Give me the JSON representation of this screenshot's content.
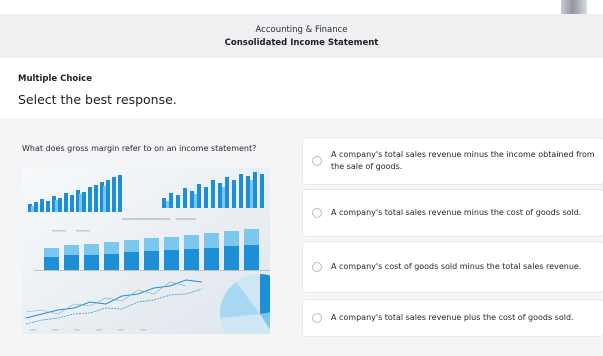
{
  "header": {
    "course": "Accounting & Finance",
    "title": "Consolidated Income Statement"
  },
  "question": {
    "type": "Multiple Choice",
    "instruction": "Select the best response.",
    "prompt": "What does gross margin refer to on an income statement?",
    "image_icon": "financial-charts-photo"
  },
  "options": [
    {
      "label": "A company's total sales revenue minus the income obtained from the sale of goods."
    },
    {
      "label": "A company's total sales revenue minus the cost of goods sold."
    },
    {
      "label": "A company's cost of goods sold minus the total sales revenue."
    },
    {
      "label": "A company's total sales revenue plus the cost of goods sold."
    }
  ],
  "colors": {
    "page_bg": "#f4f5f7",
    "header_bg": "#eef0f2",
    "card_bg": "#ffffff",
    "chart_blue": "#1d8fd6",
    "chart_light_blue": "#7cc7ee"
  }
}
